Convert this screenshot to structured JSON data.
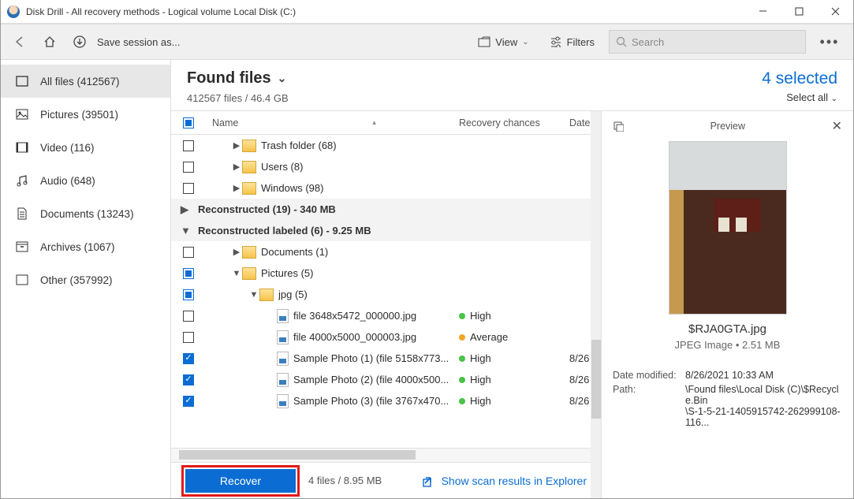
{
  "titlebar": {
    "title": "Disk Drill - All recovery methods - Logical volume Local Disk (C:)"
  },
  "toolbar": {
    "save_session": "Save session as...",
    "view_label": "View",
    "filters_label": "Filters",
    "search_placeholder": "Search"
  },
  "sidebar": {
    "items": [
      {
        "label": "All files (412567)"
      },
      {
        "label": "Pictures (39501)"
      },
      {
        "label": "Video (116)"
      },
      {
        "label": "Audio (648)"
      },
      {
        "label": "Documents (13243)"
      },
      {
        "label": "Archives (1067)"
      },
      {
        "label": "Other (357992)"
      }
    ]
  },
  "header": {
    "title": "Found files",
    "subtitle": "412567 files / 46.4 GB",
    "selected": "4 selected",
    "select_all": "Select all"
  },
  "columns": {
    "name": "Name",
    "recovery": "Recovery chances",
    "date": "Date"
  },
  "tree": {
    "rows": [
      {
        "type": "folder",
        "indent": 1,
        "label": "Trash folder (68)",
        "cb": "empty",
        "caret": "▶"
      },
      {
        "type": "folder",
        "indent": 1,
        "label": "Users (8)",
        "cb": "empty",
        "caret": "▶"
      },
      {
        "type": "folder",
        "indent": 1,
        "label": "Windows (98)",
        "cb": "empty",
        "caret": "▶"
      },
      {
        "type": "group",
        "caret": "▶",
        "label": "Reconstructed (19) - 340 MB"
      },
      {
        "type": "group",
        "caret": "▼",
        "label": "Reconstructed labeled (6) - 9.25 MB"
      },
      {
        "type": "folder",
        "indent": 1,
        "label": "Documents (1)",
        "cb": "empty",
        "caret": "▶"
      },
      {
        "type": "folder",
        "indent": 1,
        "label": "Pictures (5)",
        "cb": "partial",
        "caret": "▼"
      },
      {
        "type": "folder",
        "indent": 2,
        "label": "jpg (5)",
        "cb": "partial",
        "caret": "▼"
      },
      {
        "type": "file",
        "indent": 3,
        "label": "file 3648x5472_000000.jpg",
        "cb": "empty",
        "rec": "High",
        "recColor": "green"
      },
      {
        "type": "file",
        "indent": 3,
        "label": "file 4000x5000_000003.jpg",
        "cb": "empty",
        "rec": "Average",
        "recColor": "orange"
      },
      {
        "type": "file",
        "indent": 3,
        "label": "Sample Photo (1) (file 5158x773...",
        "cb": "checked",
        "rec": "High",
        "recColor": "green",
        "date": "8/26"
      },
      {
        "type": "file",
        "indent": 3,
        "label": "Sample Photo (2) (file 4000x500...",
        "cb": "checked",
        "rec": "High",
        "recColor": "green",
        "date": "8/26"
      },
      {
        "type": "file",
        "indent": 3,
        "label": "Sample Photo (3) (file 3767x470...",
        "cb": "checked",
        "rec": "High",
        "recColor": "green",
        "date": "8/26"
      }
    ]
  },
  "preview": {
    "heading": "Preview",
    "filename": "$RJA0GTA.jpg",
    "subtitle": "JPEG Image • 2.51 MB",
    "modified_label": "Date modified:",
    "modified_value": "8/26/2021 10:33 AM",
    "path_label": "Path:",
    "path_value1": "\\Found files\\Local Disk (C)\\$Recycle.Bin",
    "path_value2": "\\S-1-5-21-1405915742-262999108-116..."
  },
  "footer": {
    "recover": "Recover",
    "info": "4 files / 8.95 MB",
    "explorer": "Show scan results in Explorer"
  }
}
